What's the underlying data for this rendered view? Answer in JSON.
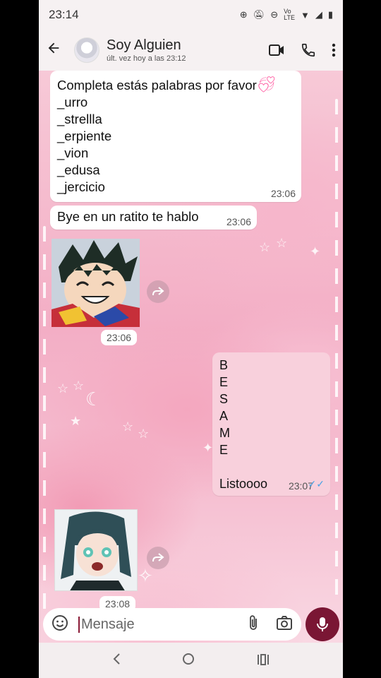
{
  "status_bar": {
    "time": "23:14",
    "network_label": "LTE"
  },
  "header": {
    "contact_name": "Soy Alguien",
    "last_seen": "últ. vez hoy a las 23:12"
  },
  "messages": [
    {
      "direction": "incoming",
      "text": "Completa estás palabras por favor",
      "emoji": "heart",
      "lines": [
        "_urro",
        "_strellla",
        "_erpiente",
        "_vion",
        "_edusa",
        "_jercicio"
      ],
      "time": "23:06"
    },
    {
      "direction": "incoming",
      "text": "Bye en un ratito te hablo",
      "time": "23:06"
    },
    {
      "direction": "incoming",
      "type": "sticker",
      "time": "23:06"
    },
    {
      "direction": "outgoing",
      "lines": [
        "B",
        "E",
        "S",
        "A",
        "M",
        "E"
      ],
      "text": "Listoooo",
      "time": "23:07",
      "read": true
    },
    {
      "direction": "incoming",
      "type": "sticker",
      "time": "23:08"
    }
  ],
  "composer": {
    "placeholder": "Mensaje"
  },
  "colors": {
    "accent": "#7a1634",
    "outgoing_bubble": "#f8d0dc",
    "incoming_bubble": "#ffffff",
    "read_ticks": "#4aa3e6"
  }
}
